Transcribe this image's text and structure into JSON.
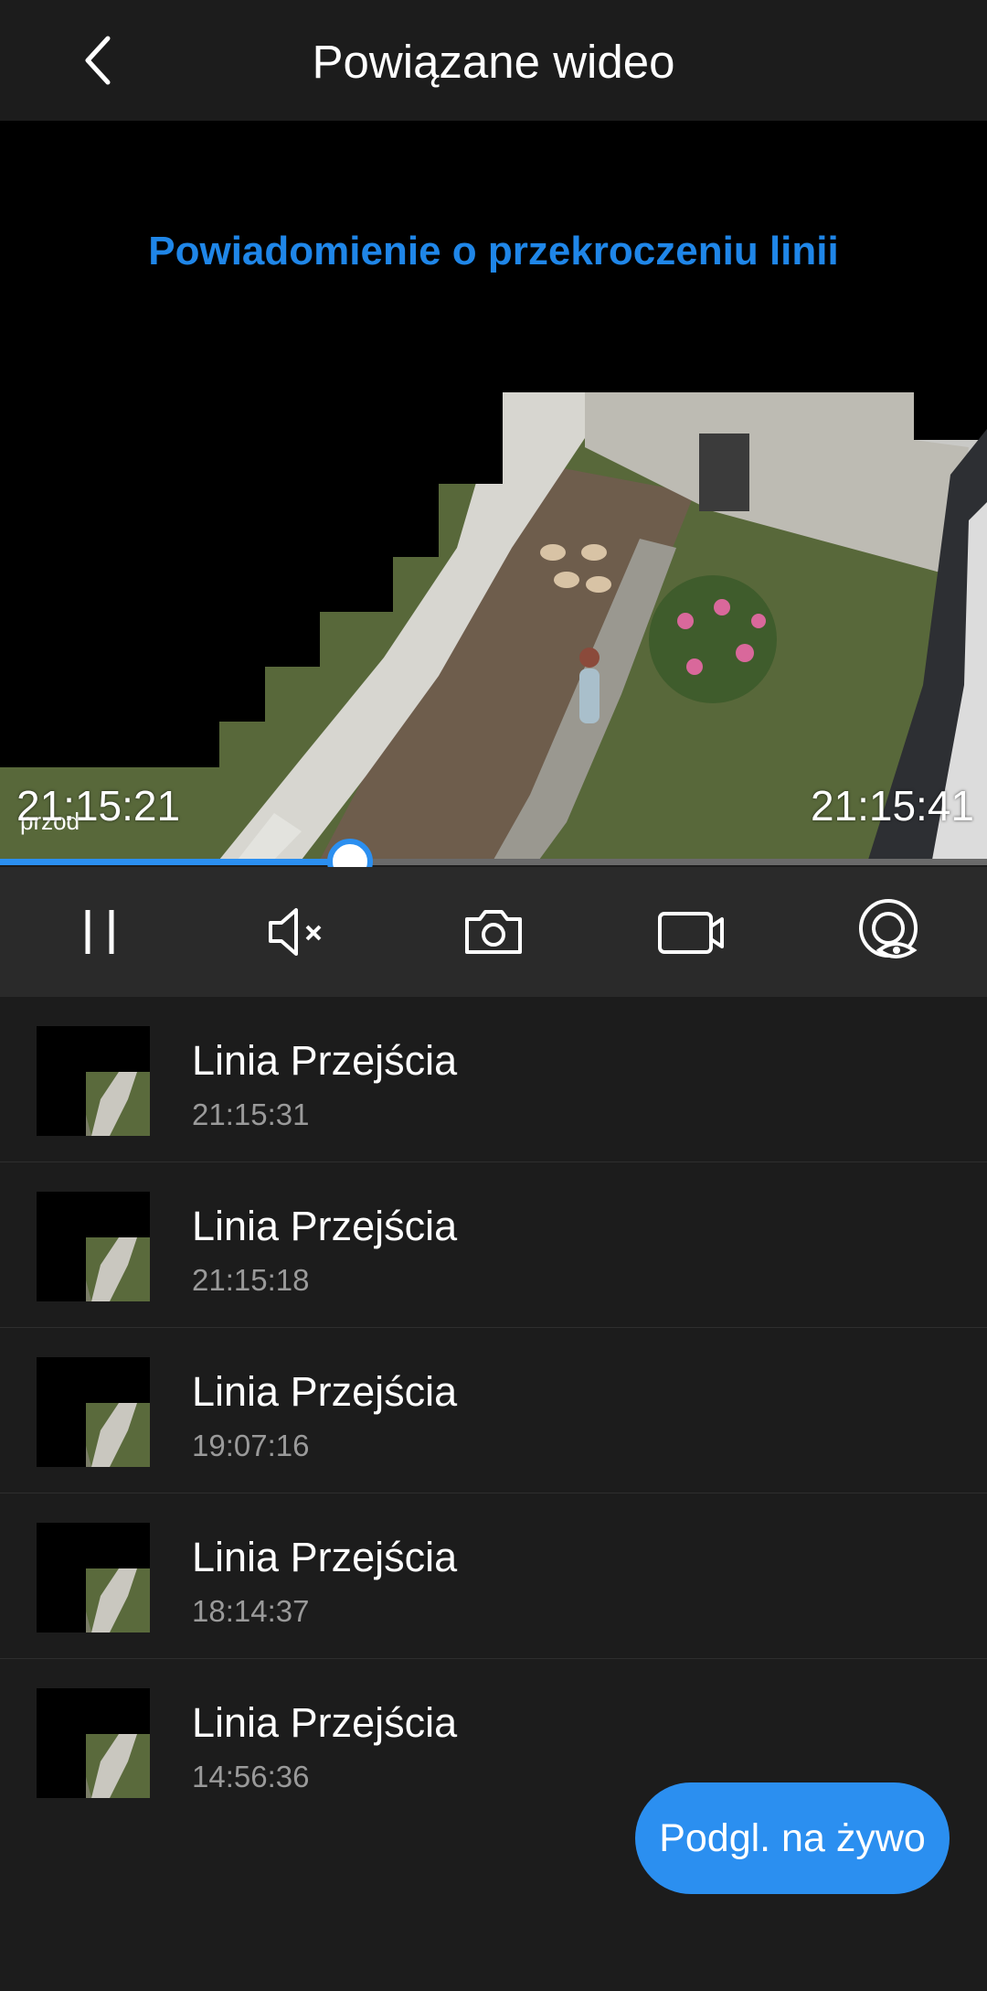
{
  "header": {
    "title": "Powiązane wideo",
    "back_icon": "chevron-left-icon"
  },
  "player": {
    "event_title": "Powiadomienie o przekroczeniu linii",
    "camera_label": "przod",
    "start_time": "21:15:21",
    "end_time": "21:15:41",
    "progress": 0.355,
    "accent_color": "#2b8ff0"
  },
  "controls": [
    {
      "name": "pause-button",
      "icon": "pause-icon"
    },
    {
      "name": "mute-button",
      "icon": "speaker-muted-icon"
    },
    {
      "name": "snapshot-button",
      "icon": "camera-icon"
    },
    {
      "name": "record-button",
      "icon": "video-camera-icon"
    },
    {
      "name": "live-view-button",
      "icon": "eye-icon"
    }
  ],
  "events": [
    {
      "title": "Linia Przejścia",
      "time": "21:15:31"
    },
    {
      "title": "Linia Przejścia",
      "time": "21:15:18"
    },
    {
      "title": "Linia Przejścia",
      "time": "19:07:16"
    },
    {
      "title": "Linia Przejścia",
      "time": "18:14:37"
    },
    {
      "title": "Linia Przejścia",
      "time": "14:56:36"
    }
  ],
  "live_button": {
    "label": "Podgl. na żywo"
  }
}
